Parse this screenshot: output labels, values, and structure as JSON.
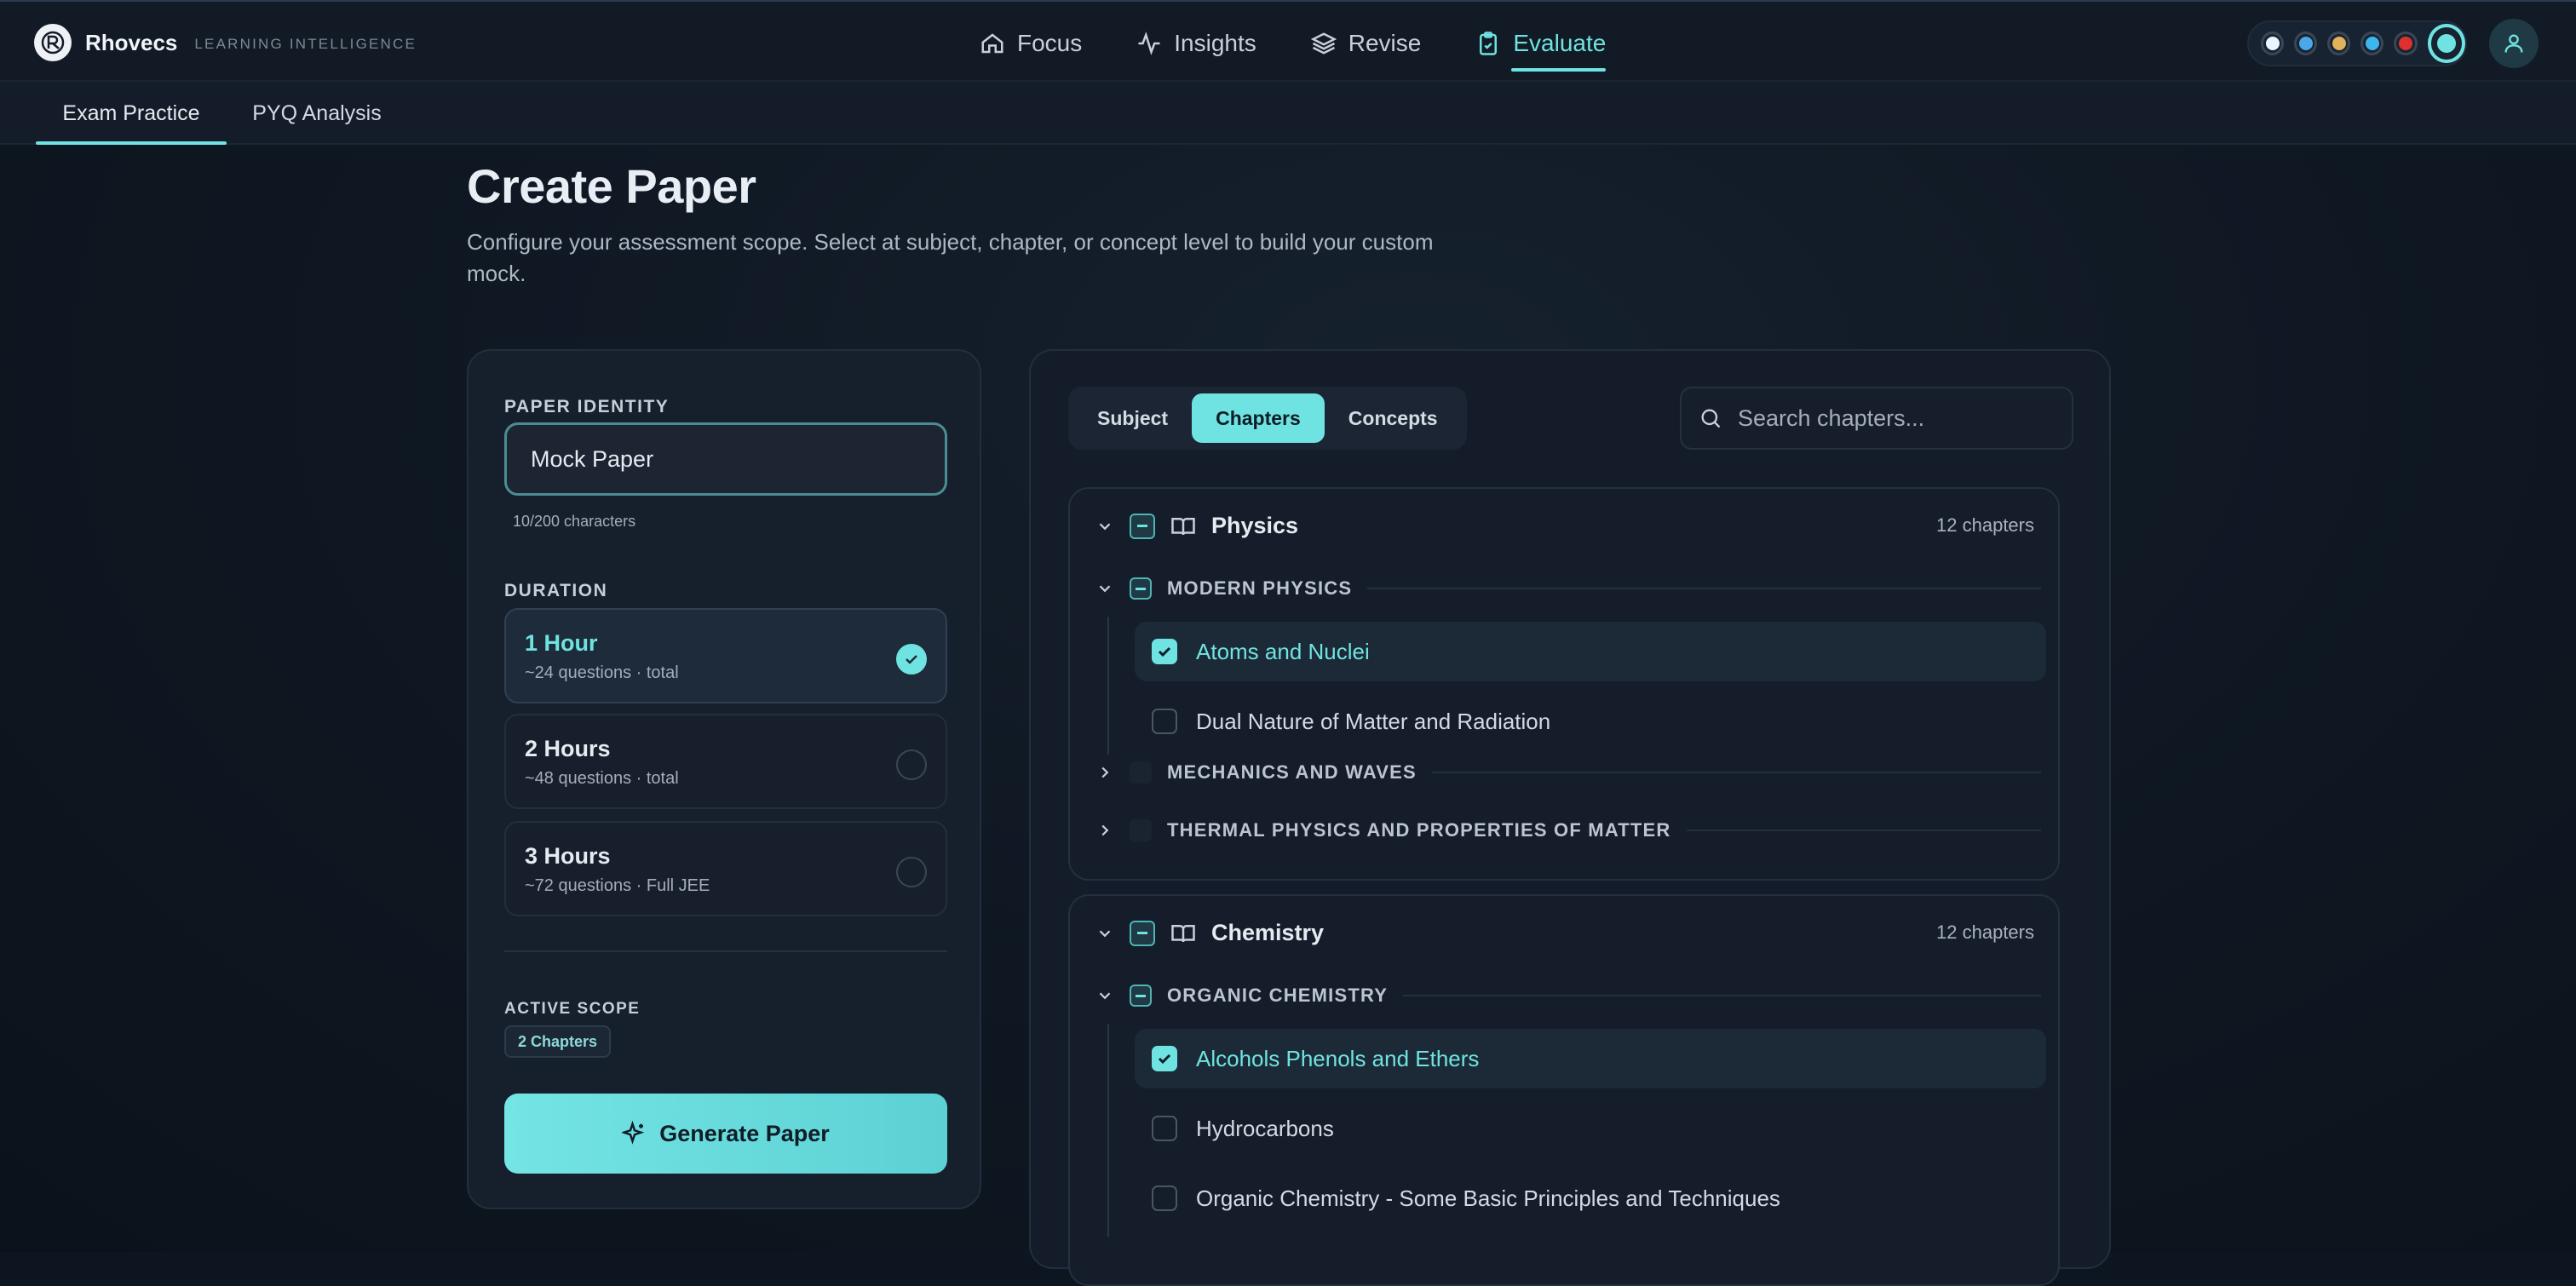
{
  "app": {
    "name": "Rhovecs",
    "tagline": "LEARNING INTELLIGENCE"
  },
  "nav": [
    {
      "label": "Focus",
      "icon": "home-icon",
      "active": false
    },
    {
      "label": "Insights",
      "icon": "activity-icon",
      "active": false
    },
    {
      "label": "Revise",
      "icon": "layers-icon",
      "active": false
    },
    {
      "label": "Evaluate",
      "icon": "clipboard-icon",
      "active": true
    }
  ],
  "theme_dots": [
    "#eaf6ff",
    "#4aa8e8",
    "#e0b25a",
    "#3db6ee",
    "#e0302e",
    "#6fe3e1"
  ],
  "subtabs": [
    {
      "label": "Exam Practice",
      "active": true
    },
    {
      "label": "PYQ Analysis",
      "active": false
    }
  ],
  "page": {
    "title": "Create Paper",
    "description": "Configure your assessment scope. Select at subject, chapter, or concept level to build your custom mock."
  },
  "paper": {
    "identity_label": "PAPER IDENTITY",
    "name_value": "Mock Paper",
    "char_count": "10/200 characters",
    "duration_label": "DURATION",
    "durations": [
      {
        "title": "1 Hour",
        "sub": "~24 questions · total",
        "selected": true
      },
      {
        "title": "2 Hours",
        "sub": "~48 questions · total",
        "selected": false
      },
      {
        "title": "3 Hours",
        "sub": "~72 questions · Full JEE",
        "selected": false
      }
    ],
    "scope_label": "ACTIVE SCOPE",
    "scope_badge": "2 Chapters",
    "generate_label": "Generate Paper"
  },
  "selector": {
    "modes": [
      {
        "label": "Subject",
        "active": false
      },
      {
        "label": "Chapters",
        "active": true
      },
      {
        "label": "Concepts",
        "active": false
      }
    ],
    "search_placeholder": "Search chapters...",
    "subjects": [
      {
        "name": "Physics",
        "count": "12 chapters",
        "groups": [
          {
            "name": "MODERN PHYSICS",
            "expanded": true,
            "chapters": [
              {
                "name": "Atoms and Nuclei",
                "selected": true
              },
              {
                "name": "Dual Nature of Matter and Radiation",
                "selected": false
              }
            ]
          },
          {
            "name": "MECHANICS AND WAVES",
            "expanded": false
          },
          {
            "name": "THERMAL PHYSICS AND PROPERTIES OF MATTER",
            "expanded": false
          }
        ]
      },
      {
        "name": "Chemistry",
        "count": "12 chapters",
        "groups": [
          {
            "name": "ORGANIC CHEMISTRY",
            "expanded": true,
            "chapters": [
              {
                "name": "Alcohols Phenols and Ethers",
                "selected": true
              },
              {
                "name": "Hydrocarbons",
                "selected": false
              },
              {
                "name": "Organic Chemistry - Some Basic Principles and Techniques",
                "selected": false
              }
            ]
          }
        ]
      }
    ]
  }
}
